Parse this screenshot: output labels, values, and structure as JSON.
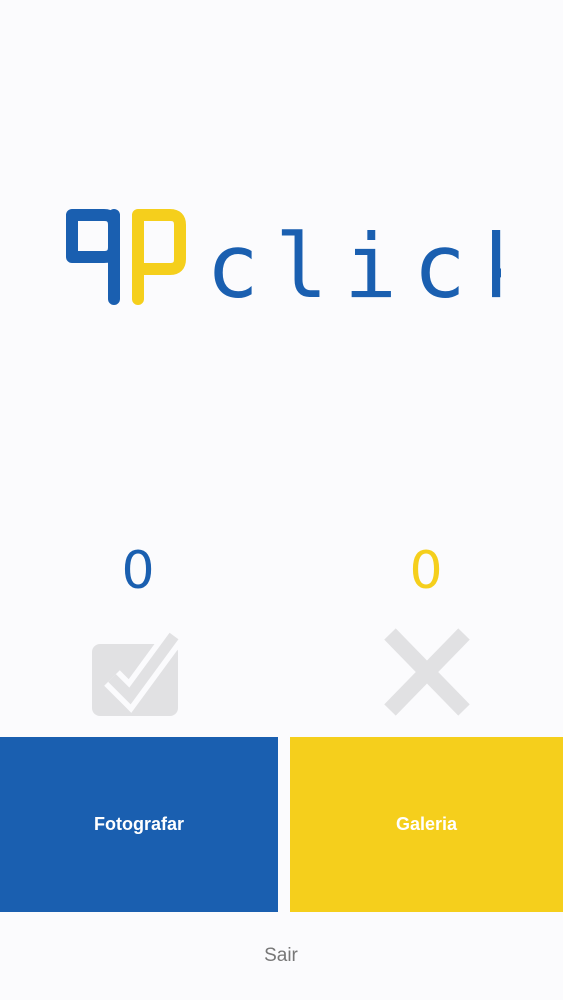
{
  "colors": {
    "brand_blue": "#1a5fb0",
    "brand_yellow": "#f5cf1c",
    "icon_gray": "#e1e1e3",
    "text_gray": "#777777",
    "background": "#fbfbfd"
  },
  "logo": {
    "text": "click"
  },
  "counters": {
    "success": "0",
    "fail": "0"
  },
  "icons": {
    "success": "checkmark-icon",
    "fail": "cross-icon"
  },
  "buttons": {
    "photograph": "Fotografar",
    "gallery": "Galeria",
    "exit": "Sair"
  }
}
